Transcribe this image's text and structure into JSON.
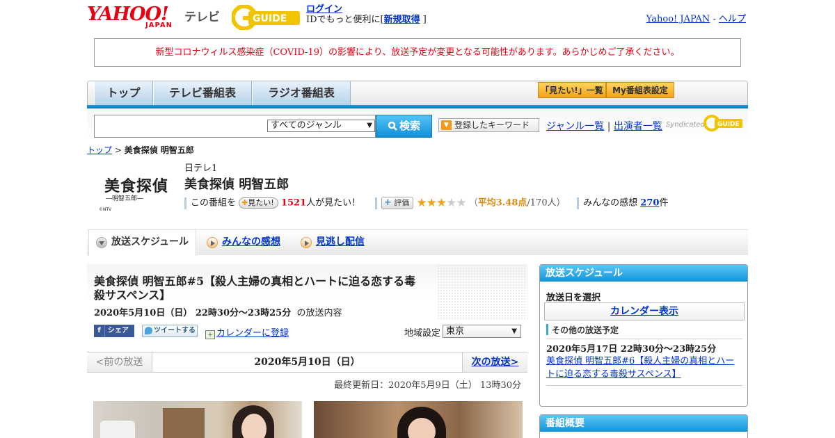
{
  "header": {
    "yahoo_text": "YAHOO!",
    "japan_text": "JAPAN",
    "tv_label": "テレビ",
    "gguide_text": "GUIDE",
    "login_label": "ログイン",
    "id_prefix": "IDでもっと便利に[",
    "signup_label": "新規取得",
    "id_suffix": "]",
    "yahoo_japan_link": "Yahoo! JAPAN",
    "dash": "-",
    "help_link": "ヘルプ"
  },
  "notice": {
    "text": "新型コロナウィルス感染症（COVID-19）の影響により、放送予定が変更となる可能性があります。あらかじめご了承ください。",
    "color": "#e60012"
  },
  "nav": {
    "tabs": [
      "トップ",
      "テレビ番組表",
      "ラジオ番組表"
    ],
    "mitai_list": "「見たい!」一覧",
    "my_bangumi": "My番組表設定"
  },
  "search": {
    "genre_selected": "すべてのジャンル",
    "search_button": "検索",
    "keyword_button": "登録したキーワード",
    "genre_link": "ジャンル一覧",
    "sep": "|",
    "performer_link": "出演者一覧",
    "syndicated_text": "Syndicated"
  },
  "breadcrumb": {
    "top": "トップ",
    "sep": ">",
    "current": "美食探偵 明智五郎"
  },
  "program": {
    "logo_title": "美食探偵",
    "logo_subtitle": "―明智五郎―",
    "logo_copyright": "©NTV",
    "channel": "日テレ1",
    "title": "美食探偵 明智五郎",
    "kono_bangumi": "この番組を",
    "mitai_button": "見たい!",
    "mitai_count": "1521",
    "mitai_suffix": "人が見たい！",
    "hyoka_button": "評価",
    "rating": 3.48,
    "stars_on": "★★★",
    "stars_off": "★★",
    "avg_open": "（",
    "avg_label": "平均3.48点",
    "avg_people": "/170人）",
    "kanso_label": "みんなの感想",
    "kanso_count": "270",
    "kanso_suffix": "件"
  },
  "tabs": {
    "schedule": "放送スケジュール",
    "reviews": "みんなの感想",
    "vod": "見逃し配信"
  },
  "episode": {
    "title": "美食探偵 明智五郎#5【殺人主婦の真相とハートに迫る恋する毒殺サスペンス】",
    "date_time": "2020年5月10日（日） 22時30分～23時25分",
    "date_suffix": "の放送内容",
    "fb_share": "シェア",
    "tweet": "ツイートする",
    "calendar_register": "カレンダーに登録",
    "region_label": "地域設定",
    "region_value": "東京"
  },
  "pager": {
    "prev": "<前の放送",
    "current": "2020年5月10日（日）",
    "next": "次の放送>"
  },
  "updated": "最終更新日：2020年5月9日（土） 13時30分",
  "sidebar": {
    "schedule_head": "放送スケジュール",
    "select_day": "放送日を選択",
    "calendar_button": "カレンダー表示",
    "other_head": "その他の放送予定",
    "other_date": "2020年5月17日 22時30分～23時25分",
    "other_link": "美食探偵 明智五郎#6【殺人主婦の真相とハートに迫る恋する毒殺サスペンス】",
    "summary_head": "番組概要"
  },
  "icons": {
    "search": "search-icon",
    "dropdown": "chevron-down-icon",
    "facebook": "facebook-icon",
    "twitter": "twitter-icon",
    "calendar": "calendar-icon"
  }
}
